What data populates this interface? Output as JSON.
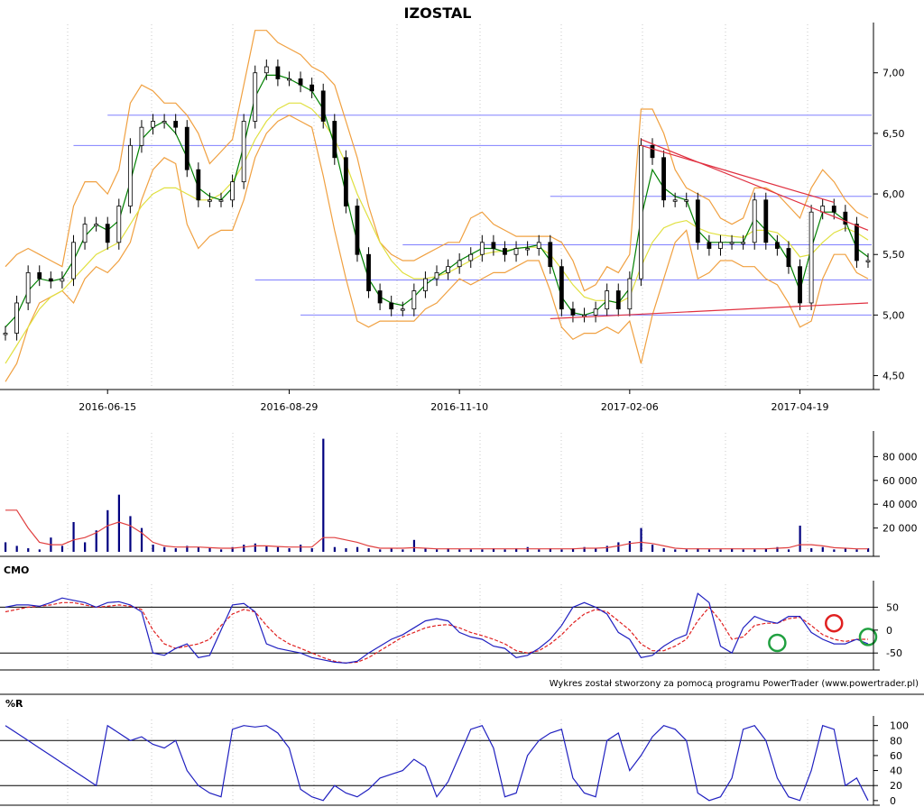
{
  "chart_data": [
    {
      "type": "candlestick",
      "title": "IZOSTAL",
      "panel": "price",
      "x_tick_labels": [
        "2016-06-15",
        "2016-08-29",
        "2016-11-10",
        "2017-02-06",
        "2017-04-19"
      ],
      "y_tick_labels": [
        "4,50",
        "5,00",
        "5,50",
        "6,00",
        "6,50",
        "7,00"
      ],
      "y_ticks": [
        4.5,
        5.0,
        5.5,
        6.0,
        6.5,
        7.0
      ],
      "ylim": [
        4.4,
        7.4
      ],
      "grid": true,
      "colors": {
        "up": "#000000",
        "down": "#000000",
        "sma_fast": "#008000",
        "sma_slow": "#e0e040",
        "bollinger": "#f0a040",
        "support": "#8080ff",
        "trend": "#e03040"
      },
      "series": [
        {
          "name": "close",
          "values": [
            4.85,
            5.1,
            5.35,
            5.3,
            5.28,
            5.3,
            5.6,
            5.75,
            5.75,
            5.6,
            5.9,
            6.4,
            6.55,
            6.6,
            6.6,
            6.55,
            6.2,
            5.95,
            5.95,
            5.95,
            6.1,
            6.6,
            7.0,
            7.05,
            6.95,
            6.95,
            6.9,
            6.85,
            6.6,
            6.3,
            5.9,
            5.5,
            5.2,
            5.1,
            5.05,
            5.05,
            5.2,
            5.3,
            5.35,
            5.4,
            5.45,
            5.5,
            5.6,
            5.55,
            5.5,
            5.55,
            5.55,
            5.6,
            5.4,
            5.05,
            5.0,
            5.0,
            5.05,
            5.2,
            5.05,
            5.3,
            6.4,
            6.3,
            5.95,
            5.95,
            5.95,
            5.6,
            5.55,
            5.6,
            5.6,
            5.6,
            5.95,
            5.6,
            5.55,
            5.4,
            5.1,
            5.85,
            5.9,
            5.85,
            5.75,
            5.45,
            5.45
          ]
        },
        {
          "name": "sma_fast",
          "values": [
            4.9,
            5.0,
            5.2,
            5.3,
            5.28,
            5.3,
            5.45,
            5.65,
            5.75,
            5.7,
            5.78,
            6.1,
            6.45,
            6.55,
            6.6,
            6.5,
            6.3,
            6.05,
            5.98,
            5.95,
            6.05,
            6.4,
            6.8,
            6.98,
            6.98,
            6.95,
            6.9,
            6.85,
            6.7,
            6.4,
            6.0,
            5.6,
            5.3,
            5.15,
            5.1,
            5.08,
            5.15,
            5.25,
            5.32,
            5.38,
            5.45,
            5.5,
            5.55,
            5.55,
            5.52,
            5.55,
            5.56,
            5.58,
            5.45,
            5.15,
            5.02,
            5.0,
            5.03,
            5.12,
            5.1,
            5.22,
            5.8,
            6.2,
            6.05,
            5.98,
            5.95,
            5.7,
            5.6,
            5.6,
            5.6,
            5.6,
            5.8,
            5.7,
            5.6,
            5.45,
            5.2,
            5.55,
            5.85,
            5.85,
            5.78,
            5.55,
            5.48
          ]
        },
        {
          "name": "sma_slow",
          "values": [
            4.6,
            4.75,
            4.9,
            5.05,
            5.15,
            5.2,
            5.3,
            5.4,
            5.5,
            5.55,
            5.6,
            5.75,
            5.9,
            6.0,
            6.05,
            6.05,
            6.0,
            5.95,
            5.95,
            6.0,
            6.1,
            6.25,
            6.45,
            6.6,
            6.7,
            6.75,
            6.75,
            6.7,
            6.6,
            6.45,
            6.25,
            6.0,
            5.8,
            5.6,
            5.45,
            5.35,
            5.3,
            5.3,
            5.32,
            5.35,
            5.4,
            5.45,
            5.5,
            5.52,
            5.53,
            5.55,
            5.56,
            5.56,
            5.5,
            5.38,
            5.25,
            5.15,
            5.12,
            5.12,
            5.1,
            5.15,
            5.4,
            5.6,
            5.72,
            5.76,
            5.78,
            5.72,
            5.68,
            5.66,
            5.65,
            5.64,
            5.7,
            5.7,
            5.68,
            5.6,
            5.48,
            5.5,
            5.6,
            5.68,
            5.72,
            5.68,
            5.62
          ]
        },
        {
          "name": "boll_upper",
          "values": [
            5.4,
            5.5,
            5.55,
            5.5,
            5.45,
            5.4,
            5.9,
            6.1,
            6.1,
            6.0,
            6.2,
            6.75,
            6.9,
            6.85,
            6.75,
            6.75,
            6.65,
            6.5,
            6.25,
            6.35,
            6.45,
            6.9,
            7.35,
            7.35,
            7.25,
            7.2,
            7.15,
            7.05,
            7.0,
            6.9,
            6.6,
            6.3,
            5.9,
            5.6,
            5.5,
            5.45,
            5.45,
            5.5,
            5.55,
            5.6,
            5.6,
            5.8,
            5.85,
            5.75,
            5.7,
            5.65,
            5.65,
            5.65,
            5.65,
            5.6,
            5.45,
            5.2,
            5.25,
            5.4,
            5.35,
            5.5,
            6.7,
            6.7,
            6.5,
            6.2,
            6.05,
            6.0,
            5.95,
            5.8,
            5.75,
            5.8,
            6.05,
            6.05,
            6.0,
            5.9,
            5.8,
            6.05,
            6.2,
            6.1,
            5.95,
            5.85,
            5.8
          ]
        },
        {
          "name": "boll_lower",
          "values": [
            4.45,
            4.6,
            4.9,
            5.1,
            5.15,
            5.2,
            5.1,
            5.3,
            5.4,
            5.35,
            5.45,
            5.6,
            5.95,
            6.2,
            6.3,
            6.25,
            5.75,
            5.55,
            5.65,
            5.7,
            5.7,
            5.95,
            6.3,
            6.5,
            6.6,
            6.65,
            6.6,
            6.55,
            6.15,
            5.7,
            5.3,
            4.95,
            4.9,
            4.95,
            4.95,
            4.95,
            4.95,
            5.05,
            5.1,
            5.2,
            5.3,
            5.25,
            5.3,
            5.35,
            5.35,
            5.4,
            5.45,
            5.45,
            5.2,
            4.9,
            4.8,
            4.85,
            4.85,
            4.9,
            4.85,
            4.95,
            4.6,
            5.0,
            5.3,
            5.6,
            5.7,
            5.3,
            5.35,
            5.45,
            5.45,
            5.4,
            5.4,
            5.3,
            5.25,
            5.1,
            4.9,
            4.95,
            5.3,
            5.5,
            5.5,
            5.35,
            5.3
          ]
        }
      ],
      "support_levels": [
        6.65,
        6.4,
        5.98,
        5.58,
        5.29,
        5.0
      ],
      "trendlines": [
        {
          "from": [
            56,
            6.45
          ],
          "to": [
            76,
            5.7
          ]
        },
        {
          "from": [
            56,
            6.4
          ],
          "to": [
            73,
            5.93
          ]
        },
        {
          "from": [
            48,
            4.97
          ],
          "to": [
            76,
            5.1
          ]
        }
      ]
    },
    {
      "type": "bar",
      "panel": "volume",
      "y_tick_labels": [
        "20 000",
        "40 000",
        "60 000",
        "80 000"
      ],
      "y_ticks": [
        20000,
        40000,
        60000,
        80000
      ],
      "ylim": [
        0,
        100000
      ],
      "colors": {
        "bars": "#000080",
        "avg": "#e04040"
      },
      "values": [
        8000,
        5000,
        3000,
        2000,
        12000,
        5000,
        25000,
        8000,
        18000,
        35000,
        48000,
        30000,
        20000,
        6000,
        4000,
        3000,
        5000,
        4000,
        3000,
        2000,
        4000,
        6000,
        7000,
        5000,
        4000,
        3000,
        6000,
        3000,
        95000,
        4000,
        3000,
        4000,
        3000,
        2000,
        3000,
        2000,
        10000,
        3000,
        2000,
        3000,
        2000,
        2000,
        2000,
        3000,
        2000,
        3000,
        4000,
        2000,
        3000,
        2000,
        3000,
        4000,
        3000,
        5000,
        8000,
        9000,
        20000,
        6000,
        3000,
        2000,
        2000,
        3000,
        2000,
        2000,
        3000,
        2000,
        2000,
        3000,
        4000,
        2000,
        22000,
        3000,
        4000,
        2000,
        3000,
        2000,
        3000
      ],
      "avg": [
        35000,
        35000,
        20000,
        8000,
        6000,
        6000,
        10000,
        12000,
        16000,
        22000,
        25000,
        22000,
        16000,
        8000,
        5000,
        4000,
        4000,
        4000,
        3500,
        3000,
        3000,
        4000,
        5000,
        5000,
        4500,
        4000,
        4000,
        4000,
        12000,
        12000,
        10000,
        8000,
        5000,
        3000,
        3000,
        3000,
        3500,
        3000,
        2500,
        2500,
        2500,
        2500,
        2500,
        2500,
        2500,
        2500,
        2500,
        2500,
        2500,
        2500,
        2500,
        3000,
        3000,
        3500,
        5000,
        7000,
        8000,
        7000,
        5000,
        3000,
        2500,
        2500,
        2500,
        2500,
        2500,
        2500,
        2500,
        2500,
        3000,
        3500,
        6000,
        6000,
        5000,
        3500,
        3000,
        2500,
        2500
      ]
    },
    {
      "type": "line",
      "panel": "CMO",
      "title": "CMO",
      "y_tick_labels": [
        "50",
        "0",
        "-50"
      ],
      "y_ticks": [
        50,
        0,
        -50
      ],
      "ylim": [
        -85,
        100
      ],
      "reference_lines": [
        50,
        -50
      ],
      "colors": {
        "cmo": "#2020c0",
        "signal": "#e02020",
        "buy_marker": "#20a040",
        "sell_marker": "#e02020"
      },
      "series": [
        {
          "name": "cmo",
          "values": [
            50,
            55,
            55,
            52,
            60,
            70,
            65,
            60,
            50,
            60,
            62,
            55,
            40,
            -50,
            -55,
            -40,
            -30,
            -60,
            -55,
            0,
            55,
            58,
            40,
            -30,
            -40,
            -45,
            -50,
            -60,
            -65,
            -70,
            -72,
            -68,
            -50,
            -35,
            -20,
            -10,
            5,
            20,
            25,
            20,
            -5,
            -15,
            -20,
            -35,
            -40,
            -60,
            -55,
            -40,
            -20,
            10,
            50,
            60,
            50,
            35,
            -5,
            -20,
            -60,
            -55,
            -35,
            -20,
            -10,
            80,
            60,
            -35,
            -50,
            5,
            30,
            20,
            15,
            30,
            30,
            -5,
            -20,
            -30,
            -30,
            -20,
            -30
          ]
        },
        {
          "name": "signal",
          "values": [
            40,
            45,
            50,
            52,
            55,
            60,
            60,
            55,
            50,
            52,
            55,
            52,
            45,
            0,
            -30,
            -40,
            -35,
            -30,
            -20,
            10,
            35,
            45,
            40,
            10,
            -15,
            -30,
            -40,
            -50,
            -60,
            -68,
            -72,
            -70,
            -60,
            -45,
            -30,
            -15,
            -5,
            5,
            10,
            12,
            5,
            -5,
            -12,
            -20,
            -30,
            -45,
            -50,
            -45,
            -30,
            -10,
            15,
            35,
            45,
            40,
            20,
            0,
            -30,
            -45,
            -45,
            -35,
            -20,
            20,
            50,
            20,
            -20,
            -15,
            10,
            15,
            15,
            25,
            28,
            10,
            -10,
            -20,
            -25,
            -20,
            -20
          ]
        }
      ],
      "markers": [
        {
          "type": "buy",
          "index": 68,
          "value": -28
        },
        {
          "type": "sell",
          "index": 73,
          "value": 15
        },
        {
          "type": "buy",
          "index": 76,
          "value": -15
        }
      ]
    },
    {
      "type": "line",
      "panel": "%R",
      "title": "%R",
      "y_tick_labels": [
        "0",
        "20",
        "40",
        "60",
        "80",
        "100"
      ],
      "y_ticks": [
        0,
        20,
        40,
        60,
        80,
        100
      ],
      "ylim": [
        -5,
        108
      ],
      "reference_lines": [
        80,
        20
      ],
      "colors": {
        "line": "#2020c0"
      },
      "values": [
        100,
        90,
        80,
        70,
        60,
        50,
        40,
        30,
        20,
        100,
        90,
        80,
        85,
        75,
        70,
        80,
        40,
        20,
        10,
        5,
        95,
        100,
        98,
        100,
        90,
        70,
        15,
        5,
        0,
        20,
        10,
        5,
        15,
        30,
        35,
        40,
        55,
        45,
        5,
        25,
        60,
        95,
        100,
        70,
        5,
        10,
        60,
        80,
        90,
        95,
        30,
        10,
        5,
        80,
        90,
        40,
        60,
        85,
        100,
        95,
        80,
        10,
        0,
        5,
        30,
        95,
        100,
        80,
        30,
        5,
        0,
        40,
        100,
        95,
        20,
        30,
        0
      ]
    }
  ],
  "footer": {
    "credit": "Wykres został stworzony za pomocą programu PowerTrader (www.powertrader.pl)"
  }
}
